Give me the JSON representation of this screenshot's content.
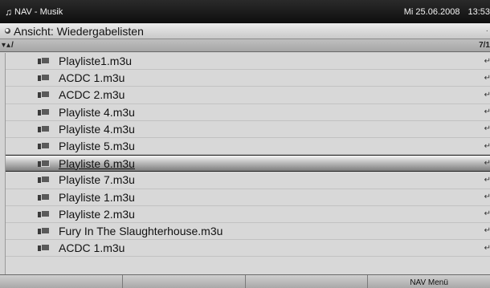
{
  "titlebar": {
    "title": "NAV - Musik",
    "date": "Mi 25.06.2008",
    "time": "13:53"
  },
  "viewbar": {
    "label": "Ansicht: Wiedergabelisten"
  },
  "pathbar": {
    "path": "▾▴/",
    "page": "7/1"
  },
  "list": {
    "items": [
      {
        "label": "Playliste1.m3u"
      },
      {
        "label": "ACDC 1.m3u"
      },
      {
        "label": "ACDC 2.m3u"
      },
      {
        "label": "Playliste 4.m3u"
      },
      {
        "label": "Playliste 4.m3u"
      },
      {
        "label": "Playliste 5.m3u"
      },
      {
        "label": "Playliste 6.m3u",
        "selected": true
      },
      {
        "label": "Playliste 7.m3u"
      },
      {
        "label": "Playliste 1.m3u"
      },
      {
        "label": "Playliste 2.m3u"
      },
      {
        "label": "Fury In The Slaughterhouse.m3u"
      },
      {
        "label": "ACDC 1.m3u"
      }
    ]
  },
  "bottombar": {
    "buttons": [
      "",
      "",
      "",
      "NAV Menü"
    ]
  },
  "icons": {
    "title": "music-note-icon",
    "view": "radio-icon",
    "item": "playlist-icon",
    "row_end": "return-arrow-icon"
  }
}
